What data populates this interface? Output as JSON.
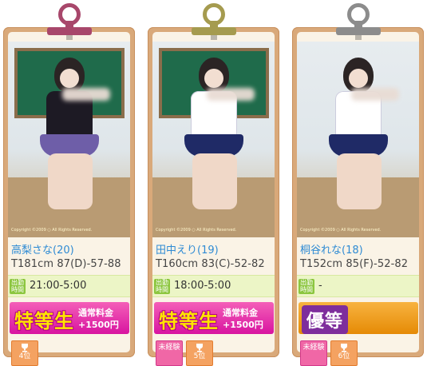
{
  "cards": [
    {
      "name": "高梨さな(20)",
      "size": "T181cm 87(D)-57-88",
      "schedule_label": "出勤時間",
      "schedule_time": "21:00-5:00",
      "photo_caption": "Copyright ©2009 ○ All Rights Reserved.",
      "rank_main": "特等生",
      "rank_sub1": "通常料金",
      "rank_sub2": "+1500円",
      "rank_style": "pink",
      "clip_color": "#a8476b",
      "uniform_color": "#1d1a24",
      "skirt_color": "#6e5ea8",
      "badges": [
        {
          "type": "rank",
          "label": "4位"
        }
      ]
    },
    {
      "name": "田中えり(19)",
      "size": "T160cm 83(C)-52-82",
      "schedule_label": "出勤時間",
      "schedule_time": "18:00-5:00",
      "photo_caption": "Copyright ©2009 ○ All Rights Reserved.",
      "rank_main": "特等生",
      "rank_sub1": "通常料金",
      "rank_sub2": "+1500円",
      "rank_style": "pink",
      "clip_color": "#a59b4f",
      "uniform_color": "#ffffff",
      "skirt_color": "#1f2a66",
      "badges": [
        {
          "type": "inexp",
          "label": "未経験"
        },
        {
          "type": "rank",
          "label": "5位"
        }
      ]
    },
    {
      "name": "桐谷れな(18)",
      "size": "T152cm 85(F)-52-82",
      "schedule_label": "出勤時間",
      "schedule_time": "-",
      "photo_caption": "Copyright ©2009 ○ All Rights Reserved.",
      "rank_main": "優等",
      "rank_sub1": "",
      "rank_sub2": "",
      "rank_style": "orange",
      "clip_color": "#8c8c8c",
      "uniform_color": "#ffffff",
      "skirt_color": "#1f2a66",
      "badges": [
        {
          "type": "inexp",
          "label": "未経験"
        },
        {
          "type": "rank",
          "label": "6位"
        }
      ]
    }
  ]
}
